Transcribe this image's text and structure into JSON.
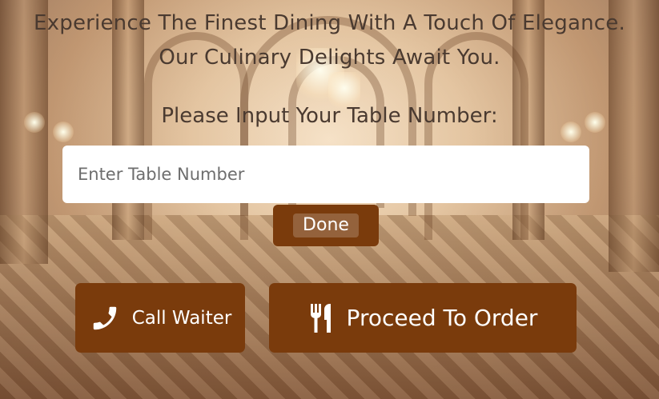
{
  "header": {
    "tagline_line1": "Experience The Finest Dining With A Touch Of Elegance.",
    "tagline_line2": "Our Culinary Delights Await You."
  },
  "table_form": {
    "prompt": "Please Input Your Table Number:",
    "input_placeholder": "Enter Table Number",
    "input_value": "",
    "done_label": "Done"
  },
  "actions": {
    "call_waiter": {
      "label": "Call Waiter",
      "icon": "phone-icon"
    },
    "proceed_order": {
      "label": "Proceed To Order",
      "icon": "fork-knife-icon"
    }
  },
  "colors": {
    "button_bg": "#7a3b0c",
    "button_text": "#ffffff",
    "heading_text": "#4a3a30",
    "input_bg": "#ffffff"
  }
}
